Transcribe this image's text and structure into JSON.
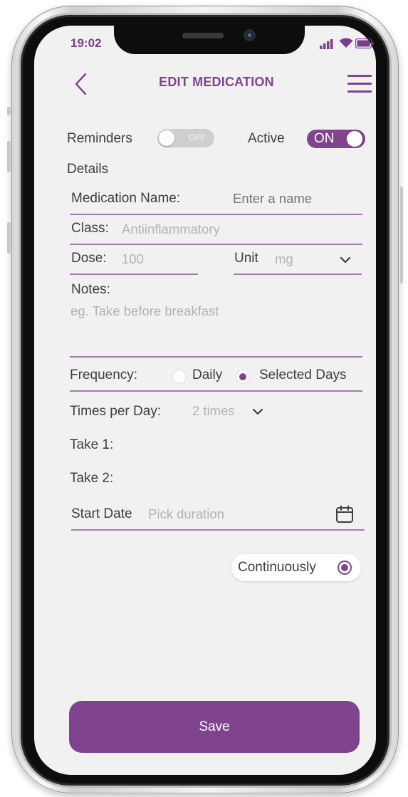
{
  "status_bar": {
    "time": "19:02",
    "icons": [
      "signal-icon",
      "wifi-icon",
      "battery-icon"
    ]
  },
  "header": {
    "title": "EDIT MEDICATION",
    "back_icon": "chevron-left-icon",
    "menu_icon": "hamburger-menu-icon"
  },
  "toggles": {
    "reminders_label": "Reminders",
    "reminders_state": "OFF",
    "active_label": "Active",
    "active_state": "ON"
  },
  "details": {
    "section_label": "Details",
    "medication_name_label": "Medication Name:",
    "medication_name_placeholder": "Enter a name",
    "class_label": "Class:",
    "class_value": "Antiinflammatory",
    "dose_label": "Dose:",
    "dose_value": "100",
    "unit_label": "Unit",
    "unit_value": "mg",
    "notes_label": "Notes:",
    "notes_placeholder": "eg. Take before breakfast"
  },
  "frequency": {
    "label": "Frequency:",
    "options": [
      "Daily",
      "Selected Days"
    ],
    "selected": "Selected Days"
  },
  "times_per_day": {
    "label": "Times per Day:",
    "value": "2 times"
  },
  "takes": [
    "Take 1:",
    "Take 2:"
  ],
  "start_date": {
    "label": "Start Date",
    "placeholder": "Pick duration",
    "icon": "calendar-icon"
  },
  "continuously": {
    "label": "Continuously",
    "selected": true
  },
  "save_button": {
    "label": "Save"
  },
  "colors": {
    "accent": "#80448f",
    "screen_bg": "#f1f1f1",
    "text": "#3e3e3e",
    "placeholder": "#b3b3b3"
  }
}
